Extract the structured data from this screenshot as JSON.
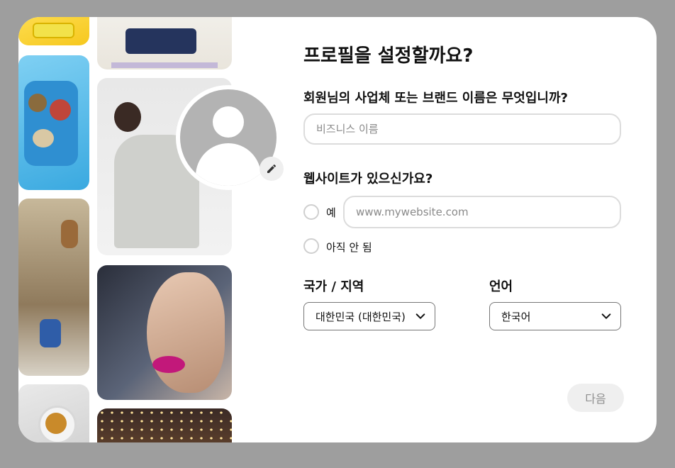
{
  "dialog": {
    "title": "프로필을 설정할까요?",
    "business_label": "회원님의 사업체 또는 브랜드 이름은 무엇입니까?",
    "business_placeholder": "비즈니스 이름",
    "website_label": "웹사이트가 있으신가요?",
    "website_yes_label": "예",
    "website_placeholder": "www.mywebsite.com",
    "website_not_yet_label": "아직 안 됨",
    "country_label": "국가 / 지역",
    "country_value": "대한민국 (대한민국)",
    "language_label": "언어",
    "language_value": "한국어",
    "next_label": "다음"
  },
  "icons": {
    "avatar": "default-avatar-icon",
    "edit": "pencil-icon",
    "dropdown": "chevron-down-icon"
  },
  "colors": {
    "overlay": "#9e9e9e",
    "avatar_gray": "#b3b3b3",
    "input_border": "#dcdcdc",
    "next_button_bg": "#efefef",
    "next_button_text": "#8f8f8f"
  }
}
